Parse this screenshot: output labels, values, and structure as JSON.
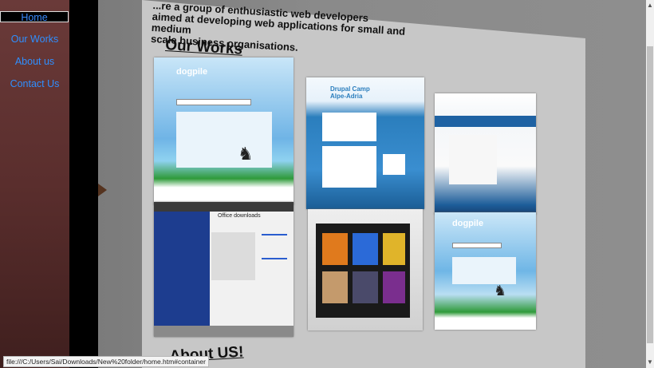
{
  "nav": {
    "home": "Home",
    "our_works": "Our Works",
    "about_us": "About us",
    "contact_us": "Contact Us"
  },
  "intro_lines": [
    "...re a group of enthusiastic web developers",
    "aimed at developing web applications for small and medium",
    "scale business organisations."
  ],
  "headings": {
    "our_works": "Our Works",
    "about_us": "About US!"
  },
  "thumbnails": {
    "dogpile_logo": "dogpile",
    "drupal_title": "Drupal Camp",
    "drupal_subtitle": "Alpe-Adria",
    "office_downloads": "Office downloads"
  },
  "status_url": "file:///C:/Users/Sai/Downloads/New%20folder/home.htm#container",
  "colors": {
    "nav_link": "#2f8fff",
    "nav_bg": "#5a2e2d",
    "panel_bg": "#c7c7c7",
    "main_bg": "#8a8a8a"
  },
  "icons": {
    "prev": "left-triangle-arrow",
    "scroll_up": "chevron-up-icon",
    "scroll_down": "chevron-down-icon"
  }
}
